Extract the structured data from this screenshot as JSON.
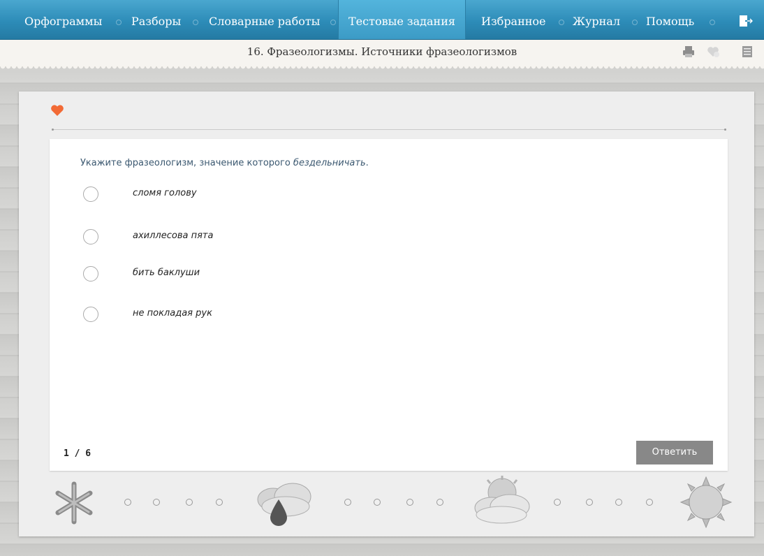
{
  "nav": {
    "items": [
      {
        "label": "Орфограммы"
      },
      {
        "label": "Разборы"
      },
      {
        "label": "Словарные работы"
      },
      {
        "label": "Тестовые задания"
      },
      {
        "label": "Избранное"
      },
      {
        "label": "Журнал"
      },
      {
        "label": "Помощь"
      }
    ],
    "active": "Тестовые задания",
    "icons": [
      "logout-icon"
    ]
  },
  "titlebar": {
    "title": "16. Фразеологизмы. Источники фразеологизмов",
    "icons": [
      "printer-icon",
      "heart-add-icon",
      "list-icon"
    ]
  },
  "task": {
    "question_prefix": "Укажите фразеологизм, значение которого ",
    "question_em": "бездельничать",
    "question_suffix": ".",
    "options": [
      {
        "label": "сломя голову"
      },
      {
        "label": "ахиллесова пята"
      },
      {
        "label": "бить баклуши"
      },
      {
        "label": "не покладая рук"
      }
    ],
    "counter": "1 / 6",
    "answer_button": "Ответить",
    "favorite_icon": "heart-icon"
  },
  "progress": {
    "icons": [
      "snowflake-icon",
      "rain-cloud-icon",
      "sun-cloud-icon",
      "sun-icon"
    ]
  },
  "colors": {
    "nav_bg": "#2d8cb8",
    "accent_heart": "#f26a35",
    "button_bg": "#888888"
  }
}
